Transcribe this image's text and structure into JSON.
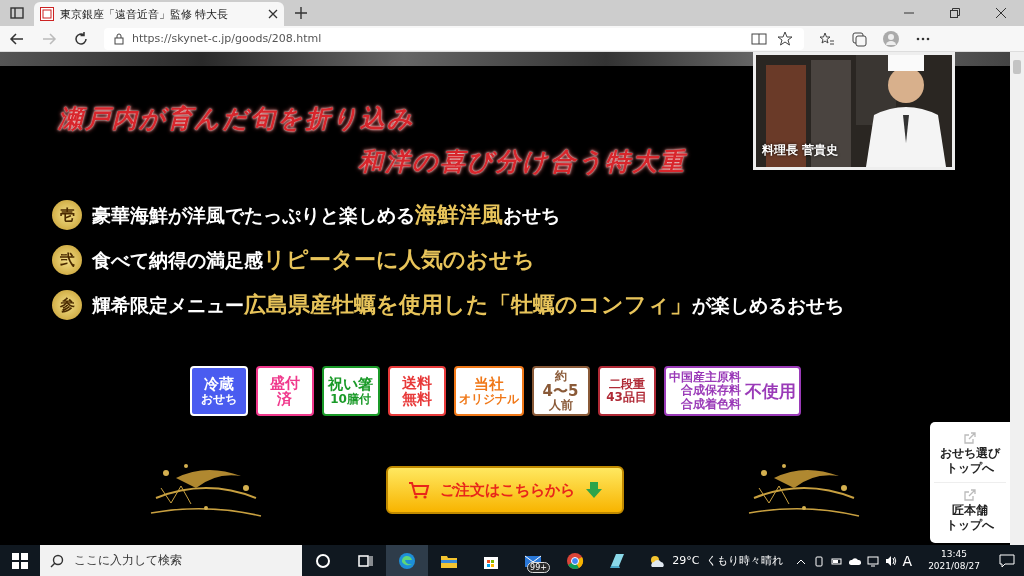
{
  "browser": {
    "tab_title": "東京銀座「遠音近音」監修 特大長",
    "url": "https://skynet-c.jp/goods/208.html"
  },
  "chef": {
    "caption": "料理長 菅貴史"
  },
  "headline": [
    "瀬戸内が育んだ旬を折り込み",
    "和洋の喜び分け合う特大重"
  ],
  "features": [
    {
      "numeral": "壱",
      "segments": [
        {
          "text": "豪華海鮮が洋風でたっぷりと楽しめる",
          "highlight": false
        },
        {
          "text": "海鮮洋風",
          "highlight": true
        },
        {
          "text": "おせち",
          "highlight": false
        }
      ]
    },
    {
      "numeral": "弐",
      "segments": [
        {
          "text": "食べて納得の満足感",
          "highlight": false
        },
        {
          "text": "リピーターに人気のおせち",
          "highlight": true
        }
      ]
    },
    {
      "numeral": "参",
      "segments": [
        {
          "text": "輝希限定メニュー",
          "highlight": false
        },
        {
          "text": "広島県産牡蠣を使用した「牡蠣のコンフィ」",
          "highlight": true
        },
        {
          "text": "が楽しめるおせち",
          "highlight": false
        }
      ]
    }
  ],
  "badges": [
    {
      "kind": "filled",
      "color": "#4a5cf0",
      "lines": [
        {
          "text": "冷蔵",
          "big": true
        },
        {
          "text": "おせち",
          "big": false
        }
      ]
    },
    {
      "kind": "outline",
      "color": "#f0388c",
      "lines": [
        {
          "text": "盛付",
          "big": true
        },
        {
          "text": "済",
          "big": true
        }
      ]
    },
    {
      "kind": "outline",
      "color": "#1a9a28",
      "lines": [
        {
          "text": "祝い箸",
          "big": true
        },
        {
          "text": "10膳付",
          "big": false
        }
      ]
    },
    {
      "kind": "outline",
      "color": "#e83a3a",
      "lines": [
        {
          "text": "送料",
          "big": true
        },
        {
          "text": "無料",
          "big": true
        }
      ]
    },
    {
      "kind": "outline",
      "color": "#f07818",
      "lines": [
        {
          "text": "当社",
          "big": true
        },
        {
          "text": "オリジナル",
          "big": false
        }
      ]
    },
    {
      "kind": "outline",
      "color": "#8a5a38",
      "lines": [
        {
          "text": "約",
          "big": false
        },
        {
          "text": "4〜5",
          "big": true
        },
        {
          "text": "人前",
          "big": false
        }
      ]
    },
    {
      "kind": "outline",
      "color": "#b02a36",
      "lines": [
        {
          "text": "二段重",
          "big": false
        },
        {
          "text": "43品目",
          "big": false
        }
      ]
    },
    {
      "kind": "wide",
      "color": "#9a3ab8",
      "lines": [
        {
          "text": "中国産主原料",
          "big": false
        },
        {
          "text": "合成保存料",
          "big": false
        },
        {
          "text": "合成着色料",
          "big": false
        },
        {
          "text": "不使用",
          "big": true
        }
      ]
    }
  ],
  "order_button": {
    "label": "ご注文はこちらから"
  },
  "side_links": [
    {
      "lines": [
        "おせち選び",
        "トップへ"
      ]
    },
    {
      "lines": [
        "匠本舗",
        "トップへ"
      ]
    }
  ],
  "taskbar": {
    "search_placeholder": "ここに入力して検索",
    "mail_badge": "99+",
    "temperature": "29°C",
    "weather": "くもり時々晴れ",
    "ime": "A",
    "time": "13:45",
    "date": "2021/08/27"
  }
}
